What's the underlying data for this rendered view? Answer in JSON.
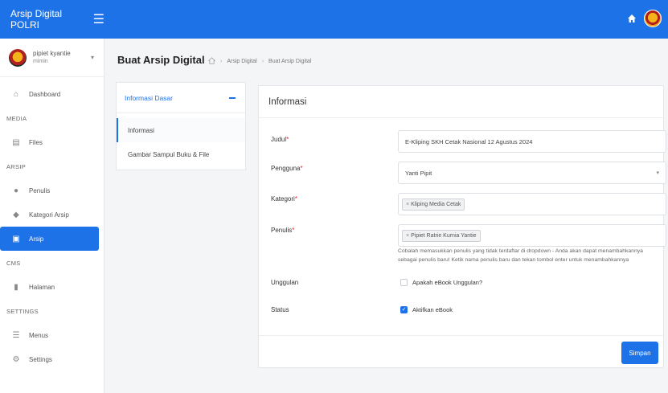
{
  "app": {
    "brand": "Arsip Digital POLRI",
    "menu_icon": "hamburger-icon"
  },
  "topbar": {
    "home_icon": "home-icon"
  },
  "user": {
    "name": "pipiet kyantie",
    "role": "mimin"
  },
  "sidebar": {
    "dashboard": "Dashboard",
    "section_media": "MEDIA",
    "files": "Files",
    "section_arsip": "ARSIP",
    "penulis": "Penulis",
    "kategori": "Kategori Arsip",
    "arsip": "Arsip",
    "section_cms": "CMS",
    "halaman": "Halaman",
    "section_settings": "SETTINGS",
    "menus": "Menus",
    "settings": "Settings"
  },
  "header": {
    "title": "Buat Arsip Digital",
    "breadcrumb": [
      "Arsip Digital",
      "Buat Arsip Digital"
    ]
  },
  "left_card": {
    "title": "Informasi Dasar",
    "tabs": [
      "Informasi",
      "Gambar Sampul Buku & File"
    ]
  },
  "form": {
    "title": "Informasi",
    "judul_label": "Judul",
    "judul_value": "E-Kliping SKH Cetak Nasional 12 Agustus 2024",
    "pengguna_label": "Pengguna",
    "pengguna_value": "Yanti Pipit",
    "kategori_label": "Kategori",
    "kategori_chip": "Kliping Media Cetak",
    "penulis_label": "Penulis",
    "penulis_chip": "Pipiet Ratrie Kurnia Yantie",
    "penulis_help": "Cobalah memasukkan penulis yang tidak terdaftar di dropdown - Anda akan dapat menambahkannya sebagai penulis baru! Ketik nama penulis baru dan tekan tombol enter untuk menambahkannya",
    "unggulan_label": "Unggulan",
    "unggulan_check": "Apakah eBook Unggulan?",
    "unggulan_checked": false,
    "status_label": "Status",
    "status_check": "Aktifkan eBook",
    "status_checked": true,
    "save": "Simpan"
  },
  "colors": {
    "accent": "#1d72e8",
    "required": "#e22233"
  }
}
